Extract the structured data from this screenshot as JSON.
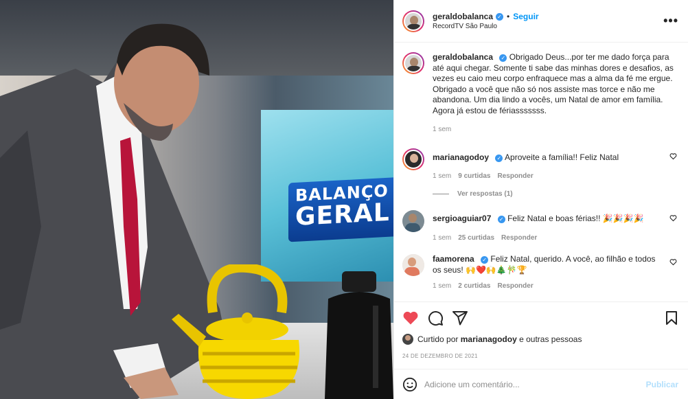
{
  "post": {
    "author": "geraldobalanca",
    "follow_label": "Seguir",
    "location": "RecordTV São Paulo",
    "more_label": "•••",
    "caption": "Obrigado Deus...por ter me dado força para até aqui chegar. Somente ti sabe das minhas dores e desafios, as vezes eu caio meu corpo enfraquece mas a alma da fé me ergue. Obrigado a você que não só nos assiste mas torce e não me abandona. Um dia lindo a vocês, um Natal de amor em família. Agora já estou de fériasssssss.",
    "caption_time": "1 sem"
  },
  "photo": {
    "logo_line1": "BALANÇO",
    "logo_line2": "GERAL"
  },
  "comments": [
    {
      "user": "marianagodoy",
      "text": "Aproveite a família!! Feliz Natal",
      "time": "1 sem",
      "likes": "9 curtidas",
      "reply": "Responder",
      "view_replies": "Ver respostas (1)"
    },
    {
      "user": "sergioaguiar07",
      "text": "Feliz Natal e boas férias!! 🎉🎉🎉🎉",
      "time": "1 sem",
      "likes": "25 curtidas",
      "reply": "Responder"
    },
    {
      "user": "faamorena",
      "text": "Feliz Natal, querido. A você, ao filhão e todos os seus! 🙌❤️🙌🎄🎋🏆",
      "time": "1 sem",
      "likes": "2 curtidas",
      "reply": "Responder"
    }
  ],
  "likes_summary": {
    "prefix": "Curtido por",
    "user": "marianagodoy",
    "suffix": "e outras pessoas"
  },
  "date": "24 DE DEZEMBRO DE 2021",
  "add_comment": {
    "placeholder": "Adicione um comentário...",
    "publish_label": "Publicar"
  },
  "colors": {
    "like_red": "#ed4956",
    "link_blue": "#0095f6",
    "verified_blue": "#3897f0"
  }
}
